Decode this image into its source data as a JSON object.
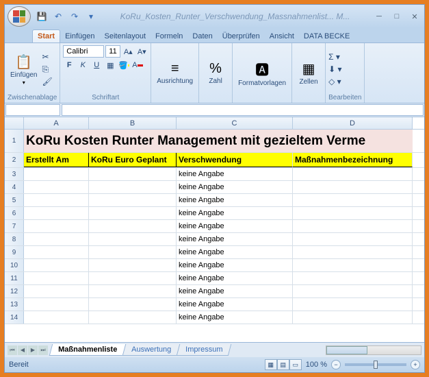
{
  "window": {
    "title": "KoRu_Kosten_Runter_Verschwendung_Massnahmenlist... M..."
  },
  "ribbon": {
    "tabs": [
      "Start",
      "Einfügen",
      "Seitenlayout",
      "Formeln",
      "Daten",
      "Überprüfen",
      "Ansicht",
      "DATA BECKE"
    ],
    "active_tab": 0,
    "clipboard": {
      "label": "Zwischenablage",
      "paste": "Einfügen"
    },
    "font": {
      "label": "Schriftart",
      "name": "Calibri",
      "size": "11"
    },
    "align": {
      "label": "Ausrichtung"
    },
    "number": {
      "label": "Zahl"
    },
    "styles": {
      "label": "Formatvorlagen"
    },
    "cells": {
      "label": "Zellen"
    },
    "editing": {
      "label": "Bearbeiten"
    }
  },
  "columns": [
    "A",
    "B",
    "C",
    "D"
  ],
  "sheet": {
    "title_row": "KoRu Kosten Runter Management mit gezieltem Verme",
    "headers": [
      "Erstellt Am",
      "KoRu Euro Geplant",
      "Verschwendung",
      "Maßnahmenbezeichnung"
    ],
    "rows": [
      {
        "n": 3,
        "c": "keine Angabe"
      },
      {
        "n": 4,
        "c": "keine Angabe"
      },
      {
        "n": 5,
        "c": "keine Angabe"
      },
      {
        "n": 6,
        "c": "keine Angabe"
      },
      {
        "n": 7,
        "c": "keine Angabe"
      },
      {
        "n": 8,
        "c": "keine Angabe"
      },
      {
        "n": 9,
        "c": "keine Angabe"
      },
      {
        "n": 10,
        "c": "keine Angabe"
      },
      {
        "n": 11,
        "c": "keine Angabe"
      },
      {
        "n": 12,
        "c": "keine Angabe"
      },
      {
        "n": 13,
        "c": "keine Angabe"
      },
      {
        "n": 14,
        "c": "keine Angabe"
      }
    ]
  },
  "tabs": {
    "items": [
      "Maßnahmenliste",
      "Auswertung",
      "Impressum"
    ],
    "active": 0
  },
  "status": {
    "text": "Bereit",
    "zoom": "100 %"
  }
}
